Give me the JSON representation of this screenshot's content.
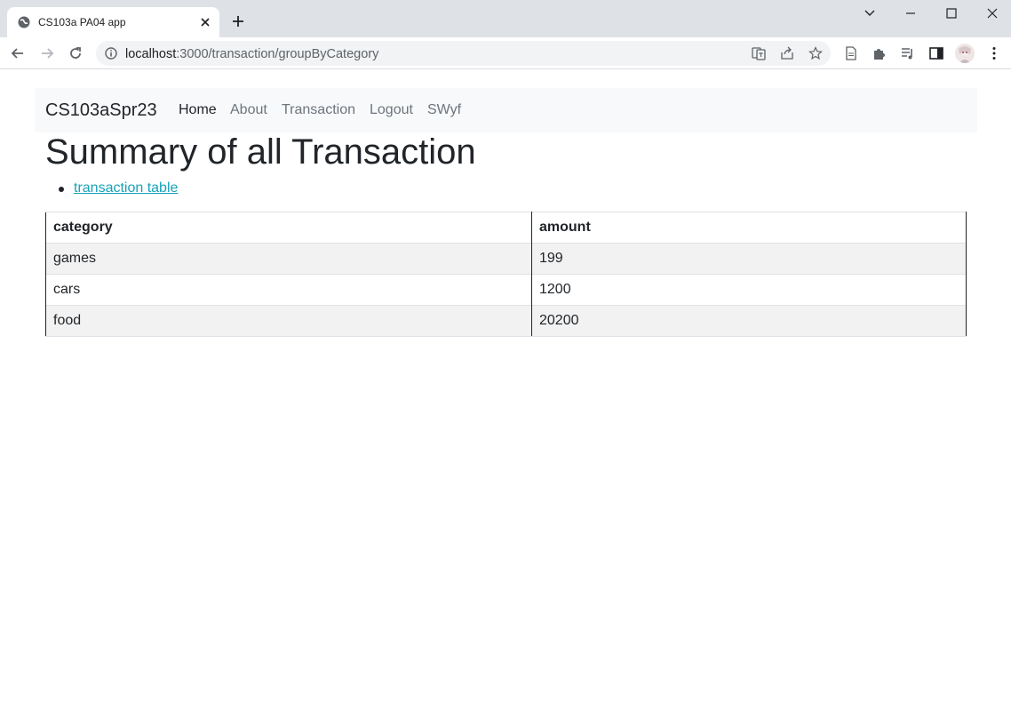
{
  "browser": {
    "tab_title": "CS103a PA04 app",
    "url_host": "localhost",
    "url_rest": ":3000/transaction/groupByCategory"
  },
  "navbar": {
    "brand": "CS103aSpr23",
    "links": [
      "Home",
      "About",
      "Transaction",
      "Logout",
      "SWyf"
    ]
  },
  "page": {
    "title": "Summary of all Transaction",
    "link_label": "transaction table"
  },
  "table": {
    "headers": [
      "category",
      "amount"
    ],
    "rows": [
      [
        "games",
        "199"
      ],
      [
        "cars",
        "1200"
      ],
      [
        "food",
        "20200"
      ]
    ]
  },
  "colors": {
    "link": "#17a2b8",
    "navbar_bg": "#f8f9fa",
    "stripe": "#f2f2f2"
  }
}
